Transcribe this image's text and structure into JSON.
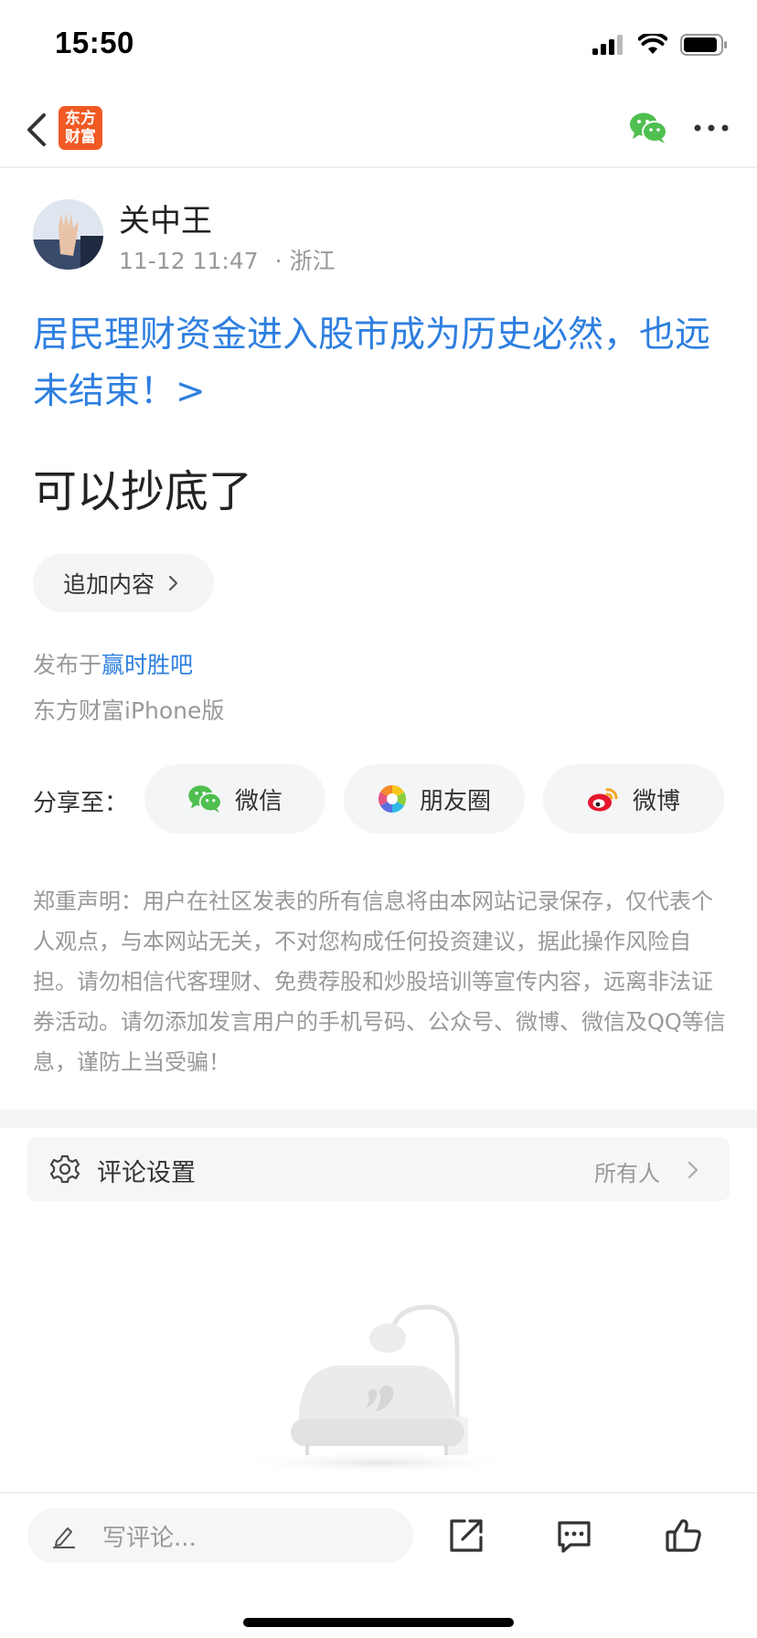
{
  "status_bar": {
    "time": "15:50",
    "icons": [
      "signal-icon",
      "wifi-icon",
      "battery-icon"
    ]
  },
  "nav": {
    "app_logo_line1": "东方",
    "app_logo_line2": "财富",
    "icons": [
      "back-arrow-icon",
      "wechat-icon",
      "more-icon"
    ],
    "brand_color": "#f15a24"
  },
  "post": {
    "author": "关中王",
    "time": "11-12 11:47",
    "dot": "·",
    "location": "浙江",
    "linked_article_title": "居民理财资金进入股市成为历史必然，也远未结束！>",
    "body": "可以抄底了",
    "append_label": "追加内容",
    "published_prefix": "发布于",
    "bar_name": "赢时胜吧",
    "device": "东方财富iPhone版"
  },
  "share": {
    "label": "分享至：",
    "options": [
      {
        "label": "微信",
        "icon": "wechat-icon"
      },
      {
        "label": "朋友圈",
        "icon": "moments-icon"
      },
      {
        "label": "微博",
        "icon": "weibo-icon"
      }
    ]
  },
  "disclaimer": "郑重声明：用户在社区发表的所有信息将由本网站记录保存，仅代表个人观点，与本网站无关，不对您构成任何投资建议，据此操作风险自担。请勿相信代客理财、免费荐股和炒股培训等宣传内容，远离非法证券活动。请勿添加发言用户的手机号码、公众号、微博、微信及QQ等信息，谨防上当受骗！",
  "comment_settings": {
    "label": "评论设置",
    "value": "所有人"
  },
  "bottom_bar": {
    "comment_placeholder": "写评论...",
    "actions": [
      "share-out-icon",
      "comment-icon",
      "like-icon"
    ]
  },
  "colors": {
    "link": "#2e7fe0",
    "muted": "#999999",
    "pill_bg": "#f4f5f6"
  }
}
